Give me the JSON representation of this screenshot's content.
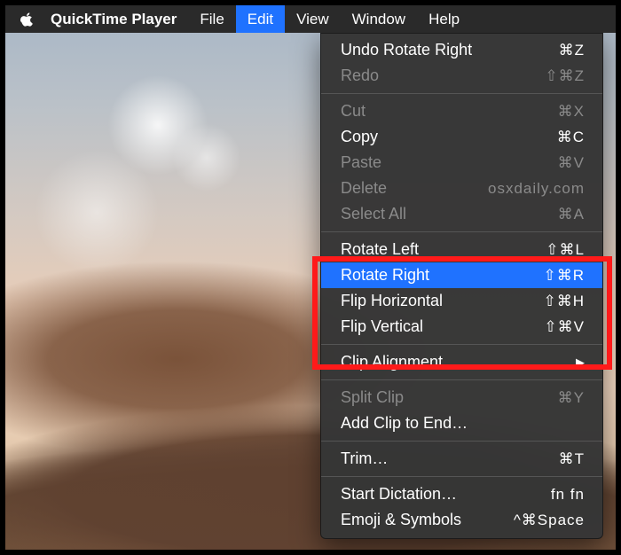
{
  "menubar": {
    "app_name": "QuickTime Player",
    "items": {
      "file": "File",
      "edit": "Edit",
      "view": "View",
      "window": "Window",
      "help": "Help"
    }
  },
  "watermark": "osxdaily.com",
  "edit_menu": {
    "undo": {
      "label": "Undo Rotate Right",
      "shortcut": "⌘Z"
    },
    "redo": {
      "label": "Redo",
      "shortcut": "⇧⌘Z"
    },
    "cut": {
      "label": "Cut",
      "shortcut": "⌘X"
    },
    "copy": {
      "label": "Copy",
      "shortcut": "⌘C"
    },
    "paste": {
      "label": "Paste",
      "shortcut": "⌘V"
    },
    "delete": {
      "label": "Delete",
      "shortcut": ""
    },
    "select_all": {
      "label": "Select All",
      "shortcut": "⌘A"
    },
    "rotate_left": {
      "label": "Rotate Left",
      "shortcut": "⇧⌘L"
    },
    "rotate_right": {
      "label": "Rotate Right",
      "shortcut": "⇧⌘R"
    },
    "flip_horizontal": {
      "label": "Flip Horizontal",
      "shortcut": "⇧⌘H"
    },
    "flip_vertical": {
      "label": "Flip Vertical",
      "shortcut": "⇧⌘V"
    },
    "clip_alignment": {
      "label": "Clip Alignment"
    },
    "split_clip": {
      "label": "Split Clip",
      "shortcut": "⌘Y"
    },
    "add_clip": {
      "label": "Add Clip to End…"
    },
    "trim": {
      "label": "Trim…",
      "shortcut": "⌘T"
    },
    "start_dictation": {
      "label": "Start Dictation…",
      "shortcut": "fn fn"
    },
    "emoji": {
      "label": "Emoji & Symbols",
      "shortcut": "^⌘Space"
    }
  }
}
